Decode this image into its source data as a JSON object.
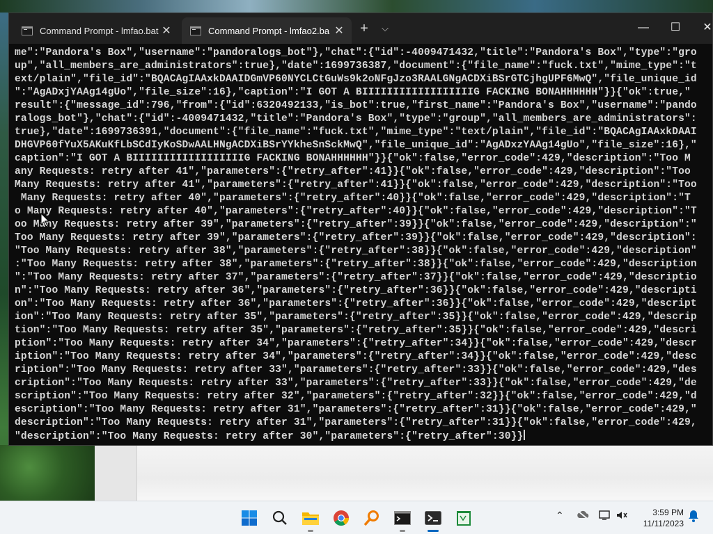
{
  "window": {
    "tabs": [
      {
        "label": "Command Prompt - lmfao.bat",
        "active": false
      },
      {
        "label": "Command Prompt - lmfao2.ba",
        "active": true
      }
    ],
    "new_tab": "+",
    "dropdown": "⌵",
    "minimize": "—",
    "maximize": "☐",
    "close": "✕",
    "tab_close": "✕"
  },
  "console": {
    "lines": [
      "me\":\"Pandora's Box\",\"username\":\"pandoralogs_bot\"},\"chat\":{\"id\":-4009471432,\"title\":\"Pandora's Box\",\"type\":\"gro",
      "up\",\"all_members_are_administrators\":true},\"date\":1699736387,\"document\":{\"file_name\":\"fuck.txt\",\"mime_type\":\"t",
      "ext/plain\",\"file_id\":\"BQACAgIAAxkDAAIDGmVP60NYCLCtGuWs9k2oNFgJzo3RAALGNgACDXiBSrGTCjhgUPF6MwQ\",\"file_unique_id",
      "\":\"AgADxjYAAg14gUo\",\"file_size\":16},\"caption\":\"I GOT A BIIIIIIIIIIIIIIIIIIG FACKING BONAHHHHHH\"}}{\"ok\":true,\"",
      "result\":{\"message_id\":796,\"from\":{\"id\":6320492133,\"is_bot\":true,\"first_name\":\"Pandora's Box\",\"username\":\"pando",
      "ralogs_bot\"},\"chat\":{\"id\":-4009471432,\"title\":\"Pandora's Box\",\"type\":\"group\",\"all_members_are_administrators\":",
      "true},\"date\":1699736391,\"document\":{\"file_name\":\"fuck.txt\",\"mime_type\":\"text/plain\",\"file_id\":\"BQACAgIAAxkDAAI",
      "DHGVP60fYuX5AKuKfLbSCdIyKoSDwAALHNgACDXiBSrYYkheSnSckMwQ\",\"file_unique_id\":\"AgADxzYAAg14gUo\",\"file_size\":16},\"",
      "caption\":\"I GOT A BIIIIIIIIIIIIIIIIIIG FACKING BONAHHHHHH\"}}{\"ok\":false,\"error_code\":429,\"description\":\"Too M",
      "any Requests: retry after 41\",\"parameters\":{\"retry_after\":41}}{\"ok\":false,\"error_code\":429,\"description\":\"Too",
      "Many Requests: retry after 41\",\"parameters\":{\"retry_after\":41}}{\"ok\":false,\"error_code\":429,\"description\":\"Too",
      " Many Requests: retry after 40\",\"parameters\":{\"retry_after\":40}}{\"ok\":false,\"error_code\":429,\"description\":\"T",
      "o Many Requests: retry after 40\",\"parameters\":{\"retry_after\":40}}{\"ok\":false,\"error_code\":429,\"description\":\"T",
      "oo Many Requests: retry after 39\",\"parameters\":{\"retry_after\":39}}{\"ok\":false,\"error_code\":429,\"description\":\"",
      "Too Many Requests: retry after 39\",\"parameters\":{\"retry_after\":39}}{\"ok\":false,\"error_code\":429,\"description\":",
      "\"Too Many Requests: retry after 38\",\"parameters\":{\"retry_after\":38}}{\"ok\":false,\"error_code\":429,\"description\"",
      ":\"Too Many Requests: retry after 38\",\"parameters\":{\"retry_after\":38}}{\"ok\":false,\"error_code\":429,\"description",
      "\":\"Too Many Requests: retry after 37\",\"parameters\":{\"retry_after\":37}}{\"ok\":false,\"error_code\":429,\"descriptio",
      "n\":\"Too Many Requests: retry after 36\",\"parameters\":{\"retry_after\":36}}{\"ok\":false,\"error_code\":429,\"descripti",
      "on\":\"Too Many Requests: retry after 36\",\"parameters\":{\"retry_after\":36}}{\"ok\":false,\"error_code\":429,\"descript",
      "ion\":\"Too Many Requests: retry after 35\",\"parameters\":{\"retry_after\":35}}{\"ok\":false,\"error_code\":429,\"descrip",
      "tion\":\"Too Many Requests: retry after 35\",\"parameters\":{\"retry_after\":35}}{\"ok\":false,\"error_code\":429,\"descri",
      "ption\":\"Too Many Requests: retry after 34\",\"parameters\":{\"retry_after\":34}}{\"ok\":false,\"error_code\":429,\"descr",
      "iption\":\"Too Many Requests: retry after 34\",\"parameters\":{\"retry_after\":34}}{\"ok\":false,\"error_code\":429,\"desc",
      "ription\":\"Too Many Requests: retry after 33\",\"parameters\":{\"retry_after\":33}}{\"ok\":false,\"error_code\":429,\"des",
      "cription\":\"Too Many Requests: retry after 33\",\"parameters\":{\"retry_after\":33}}{\"ok\":false,\"error_code\":429,\"de",
      "scription\":\"Too Many Requests: retry after 32\",\"parameters\":{\"retry_after\":32}}{\"ok\":false,\"error_code\":429,\"d",
      "escription\":\"Too Many Requests: retry after 31\",\"parameters\":{\"retry_after\":31}}{\"ok\":false,\"error_code\":429,\"",
      "description\":\"Too Many Requests: retry after 31\",\"parameters\":{\"retry_after\":31}}{\"ok\":false,\"error_code\":429,",
      "\"description\":\"Too Many Requests: retry after 30\",\"parameters\":{\"retry_after\":30}}"
    ]
  },
  "taskbar": {
    "apps": [
      {
        "name": "start-icon"
      },
      {
        "name": "search-icon"
      },
      {
        "name": "file-explorer-icon"
      },
      {
        "name": "chrome-icon"
      },
      {
        "name": "search-tool-icon"
      },
      {
        "name": "command-prompt-icon"
      },
      {
        "name": "terminal-icon"
      },
      {
        "name": "notepad-icon"
      }
    ],
    "time": "3:59 PM",
    "date": "11/11/2023"
  },
  "colors": {
    "terminal_bg": "#0c0c0c",
    "terminal_text": "#d6d6d6",
    "titlebar": "#202020",
    "taskbar": "#f0f3f6",
    "accent": "#0067c0"
  }
}
